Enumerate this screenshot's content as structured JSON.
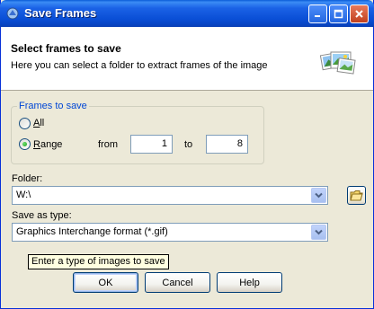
{
  "window": {
    "title": "Save Frames"
  },
  "titlebar_buttons": [
    "minimize-icon",
    "maximize-icon",
    "close-icon"
  ],
  "header": {
    "title": "Select frames to save",
    "subtitle": "Here you can select a folder to extract frames of the image",
    "icon": "photos-icon"
  },
  "frames": {
    "legend": "Frames to save",
    "all_label": "All",
    "range_label": "Range",
    "selected": "Range",
    "from_label": "from",
    "from_value": "1",
    "to_label": "to",
    "to_value": "8"
  },
  "folder": {
    "label": "Folder:",
    "value": "W:\\",
    "browse_icon": "folder-icon"
  },
  "save_type": {
    "label": "Save as type:",
    "value": "Graphics Interchange format (*.gif)"
  },
  "tooltip": "Enter a type of images to save",
  "buttons": {
    "ok": "OK",
    "cancel": "Cancel",
    "help": "Help"
  },
  "colors": {
    "title_bar": "#0a4fd6",
    "legend": "#0046d5",
    "dialog_bg": "#ece9d8",
    "tooltip_bg": "#ffffe1"
  }
}
